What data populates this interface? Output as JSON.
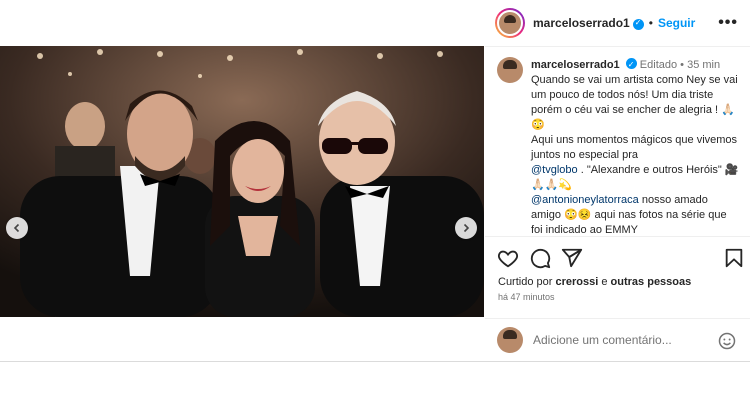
{
  "header": {
    "username": "marceloserrado1",
    "separator": "•",
    "follow_label": "Seguir",
    "more_label": "•••"
  },
  "comment": {
    "username": "marceloserrado1",
    "edited": "Editado",
    "dot": "•",
    "time_ago": "35 min",
    "lines": [
      "Quando se vai um artista como Ney se vai um pouco de todos nós! Um dia triste porém o céu vai se encher de alegria ! 🙏🏻😳",
      "Aqui uns momentos mágicos que vivemos juntos no especial pra",
      ". \"Alexandre e outros Heróis\" 🎥🙏🏻🙏🏻💫",
      "nosso amado amigo 😳😣 aqui nas fotos na série que foi indicado ao EMMY"
    ],
    "mention_1": "@tvglobo",
    "mention_2": "@antonioneylatorraca"
  },
  "likes": {
    "prefix": "Curtido por",
    "user": "crerossi",
    "conj": "e",
    "others": "outras pessoas"
  },
  "posted_time": "há 47 minutos",
  "add_comment": {
    "placeholder": "Adicione um comentário..."
  },
  "carousel": {
    "slide_count": 8,
    "active_index": 4
  },
  "icons": {
    "like": "heart-icon",
    "comment": "comment-icon",
    "share": "send-icon",
    "save": "bookmark-icon",
    "prev": "chevron-left-icon",
    "next": "chevron-right-icon",
    "emoji": "emoji-icon"
  },
  "colors": {
    "accent": "#0095f6",
    "mention": "#00376b",
    "muted": "#737373"
  }
}
